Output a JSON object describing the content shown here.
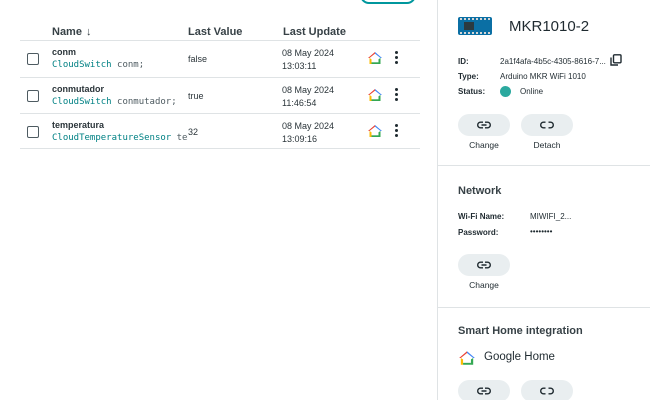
{
  "table": {
    "headers": {
      "name": "Name",
      "sort_arrow": "↓",
      "last_value": "Last Value",
      "last_update": "Last Update"
    },
    "rows": [
      {
        "name": "conm",
        "type": "CloudSwitch",
        "decl_rest": " conm;",
        "value": "false",
        "date": "08 May 2024",
        "time": "13:03:11"
      },
      {
        "name": "conmutador",
        "type": "CloudSwitch",
        "decl_rest": " conmutador;",
        "value": "true",
        "date": "08 May 2024",
        "time": "11:46:54"
      },
      {
        "name": "temperatura",
        "type": "CloudTemperatureSensor",
        "decl_rest": " temp…",
        "value": "32",
        "date": "08 May 2024",
        "time": "13:09:16"
      }
    ]
  },
  "device": {
    "title": "MKR1010-2",
    "id_label": "ID:",
    "id_value": "2a1f4afa-4b5c-4305-8616-7...",
    "type_label": "Type:",
    "type_value": "Arduino MKR WiFi 1010",
    "status_label": "Status:",
    "status_value": "Online",
    "status_color": "#2ba99f",
    "change_label": "Change",
    "detach_label": "Detach"
  },
  "network": {
    "title": "Network",
    "wifi_label": "Wi-Fi Name:",
    "wifi_value": "MIWIFI_2...",
    "password_label": "Password:",
    "password_value": "••••••••",
    "change_label": "Change"
  },
  "smart_home": {
    "title": "Smart Home integration",
    "provider": "Google Home"
  },
  "colors": {
    "accent": "#008184",
    "online": "#2ba99f",
    "divider": "#dfe3e5"
  },
  "icons": [
    "google-home-icon",
    "kebab-menu-icon",
    "copy-icon",
    "link-icon",
    "unlink-icon",
    "board-icon"
  ]
}
